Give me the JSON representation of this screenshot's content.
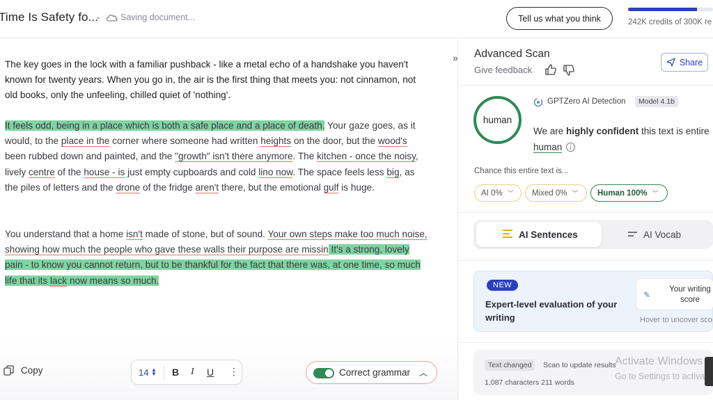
{
  "header": {
    "doc_title": "Time Is Safety fo...",
    "saving_status": "Saving document...",
    "feedback_button": "Tell us what you think",
    "credits_text": "242K credits of 300K re",
    "credits_fraction": 0.81,
    "accent_color": "#2a3fbf"
  },
  "editor": {
    "p1": "The key goes in the lock with a familiar pushback - like a metal echo of a handshake you haven't known for twenty years. When you go in, the air is the first thing that meets you: not cinnamon, not old books, only the unfeeling, chilled quiet of 'nothing'.",
    "p2": {
      "a": "It feels odd, being in a place which is both a safe place and a place of death.",
      "b": " Your gaze goes, as it would, to the ",
      "c": "place in the",
      "d": " corner where someone had written ",
      "e": "heights",
      "f": " on the door, but the ",
      "g": "wood's",
      "h": " been rubbed down and painted, and the ",
      "i": "\"growth\" isn't there anymore",
      "j": ".  The ",
      "k": "kitchen - ",
      "l": "once the ",
      "m": "noisy",
      "n": ", lively ",
      "o": "centre",
      "p": " of the ",
      "q": "house - is",
      "r": " just empty cupboards and cold ",
      "s": "lino now",
      "t": ". The space feels less ",
      "u": "big",
      "v": ", as the piles of letters and the ",
      "w": "drone",
      "x": " of the fridge ",
      "y": "aren't",
      "z": " there, but the emotional ",
      "aa": "gulf",
      "ab": " is huge."
    },
    "p3": {
      "a": "You understand that a home ",
      "b": "isn't",
      "c": " made of stone, but of sound. ",
      "d": "Your own steps make too much noise, showing how much the people who gave these walls their purpose are missin",
      "e": " It's a strong, lovely pain - to know you cannot return, but to be thankful for the fact that there was, at one time, so much life that its ",
      "f": "lack",
      "g": " now means so much."
    },
    "copy_label": "Copy",
    "font_size": "14",
    "bold_label": "B",
    "italic_label": "I",
    "underline_label": "U",
    "more_label": "⋮",
    "grammar_label": "Correct grammar",
    "grammar_enabled": true,
    "collapse_glyph": "»"
  },
  "panel": {
    "title": "Advanced Scan",
    "give_feedback": "Give feedback",
    "share_label": "Share",
    "verdict": "human",
    "detector_name": "GPTZero AI Detection",
    "model_badge": "Model 4.1b",
    "confidence_prefix": "We are ",
    "confidence_bold": "highly confident",
    "confidence_suffix": " this text is entire",
    "verdict_word": "human",
    "chance_label": "Chance this entire text is...",
    "pills": [
      {
        "label": "AI 0%"
      },
      {
        "label": "Mixed 0%"
      },
      {
        "label": "Human 100%"
      }
    ],
    "tabs": [
      {
        "label": "AI Sentences"
      },
      {
        "label": "AI Vocab"
      }
    ],
    "promo": {
      "badge": "NEW",
      "text": "Expert-level evaluation of your writing",
      "score_card": "Your writing score",
      "hover_text": "Hover to uncover sco"
    },
    "status": {
      "changed_badge": "Text changed",
      "scan_update": "Scan to update results",
      "counts": "1,087 characters 211 words"
    },
    "watermark_title": "Activate Windows",
    "watermark_sub": "Go to Settings to activa",
    "colors": {
      "human_green": "#2f8a55",
      "highlight_green": "#7fd4a3",
      "underline_red": "#e07a64"
    }
  }
}
